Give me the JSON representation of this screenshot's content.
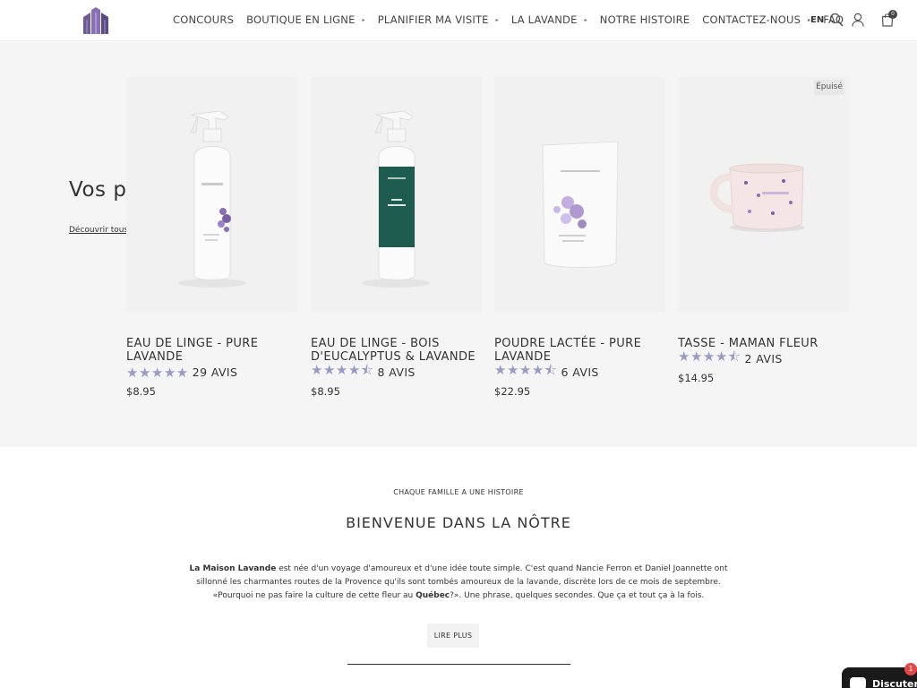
{
  "header": {
    "nav": [
      {
        "label": "CONCOURS",
        "has_caret": false
      },
      {
        "label": "BOUTIQUE EN LIGNE",
        "has_caret": true
      },
      {
        "label": "PLANIFIER MA VISITE",
        "has_caret": true
      },
      {
        "label": "LA LAVANDE",
        "has_caret": true
      },
      {
        "label": "NOTRE HISTOIRE",
        "has_caret": false
      },
      {
        "label": "CONTACTEZ-NOUS",
        "has_caret": true
      },
      {
        "label": "FAQ",
        "has_caret": false
      }
    ],
    "lang": "EN",
    "cart_count": "0"
  },
  "favorites": {
    "title": "Vos prefs.",
    "link": "Découvrir tous les produits"
  },
  "products": [
    {
      "name": "EAU DE LINGE - PURE LAVANDE",
      "stars": "★★★★★",
      "reviews": "29 AVIS",
      "price": "$8.95"
    },
    {
      "name": "EAU DE LINGE - BOIS D'EUCALYPTUS & LAVANDE",
      "stars": "★★★★⯪",
      "reviews": "8 AVIS",
      "price": "$8.95"
    },
    {
      "name": "POUDRE LACTÉE - PURE LAVANDE",
      "stars": "★★★★⯪",
      "reviews": "6 AVIS",
      "price": "$22.95"
    },
    {
      "name": "TASSE - MAMAN FLEUR",
      "stars": "★★★★⯪",
      "reviews": "2 AVIS",
      "price": "$14.95",
      "badge": "Épuisé"
    }
  ],
  "about": {
    "eyebrow": "CHAQUE FAMILLE A UNE HISTOIRE",
    "title": "BIENVENUE DANS LA NÔTRE",
    "brand": "La Maison Lavande",
    "text_1": " est née d'un voyage d'amoureux et d'une idée toute simple. C'est quand Nancie Ferron et Daniel Joannette ont sillonné les charmantes routes de la Provence qu'ils sont tombés amoureux de la lavande, discrète lors de ce mois de septembre. «Pourquoi ne pas faire la culture de cette fleur au ",
    "place": "Québec",
    "text_2": "?». Une phrase, quelques secondes. Que ça et tout ça à la fois.",
    "button": "LIRE PLUS"
  },
  "chat": {
    "label": "Discuter",
    "count": "1"
  }
}
